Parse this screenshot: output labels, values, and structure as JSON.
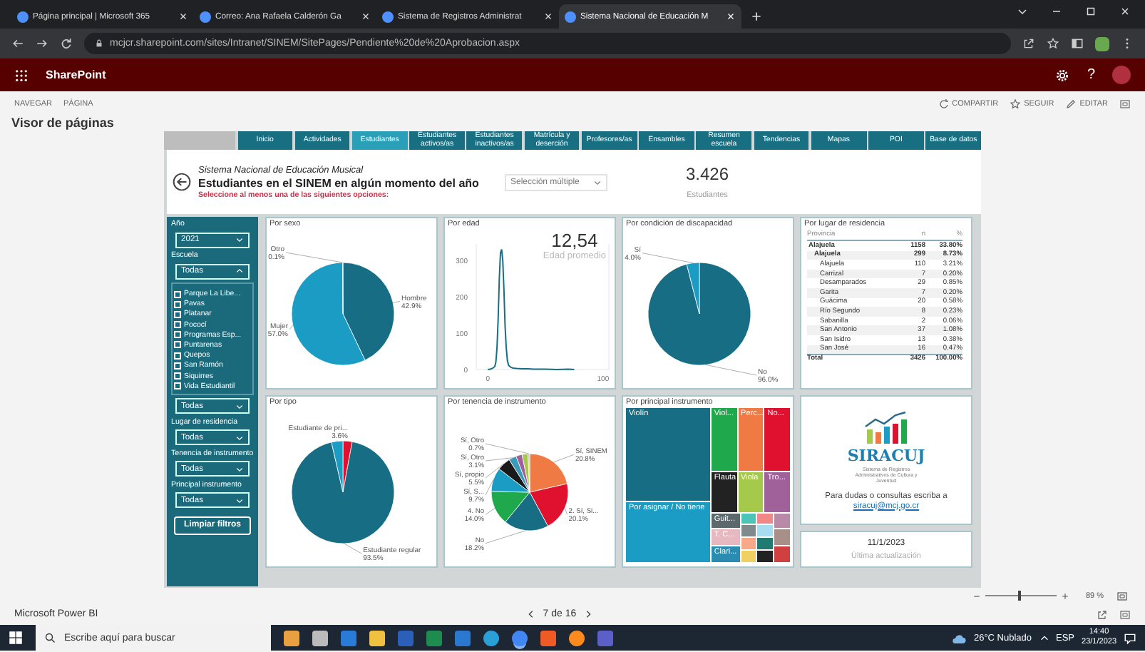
{
  "browser": {
    "tabs": [
      {
        "title": "Página principal | Microsoft 365",
        "selected": false
      },
      {
        "title": "Correo: Ana Rafaela Calderón Ga",
        "selected": false
      },
      {
        "title": "Sistema de Registros Administrat",
        "selected": false
      },
      {
        "title": "Sistema Nacional de Educación M",
        "selected": true
      }
    ],
    "address": "mcjcr.sharepoint.com/sites/Intranet/SINEM/SitePages/Pendiente%20de%20Aprobacion.aspx"
  },
  "suite_bar": {
    "title": "SharePoint",
    "help": "?"
  },
  "page_bar": {
    "nav": [
      "NAVEGAR",
      "PÁGINA"
    ],
    "actions": [
      "COMPARTIR",
      "SEGUIR",
      "EDITAR"
    ],
    "title": "Visor de páginas"
  },
  "report": {
    "tabs": [
      {
        "label": "Inicio",
        "selected": false
      },
      {
        "label": "Actividades",
        "selected": false
      },
      {
        "label": "Estudiantes",
        "selected": true
      },
      {
        "label": "Estudiantes activos/as",
        "selected": false
      },
      {
        "label": "Estudiantes inactivos/as",
        "selected": false
      },
      {
        "label": "Matrícula y deserción",
        "selected": false
      },
      {
        "label": "Profesores/as",
        "selected": false
      },
      {
        "label": "Ensambles",
        "selected": false
      },
      {
        "label": "Resumen escuela",
        "selected": false
      },
      {
        "label": "Tendencias",
        "selected": false
      },
      {
        "label": "Mapas",
        "selected": false
      },
      {
        "label": "POI",
        "selected": false
      },
      {
        "label": "Base de datos",
        "selected": false
      }
    ],
    "header": {
      "subtitle": "Sistema Nacional de Educación Musical",
      "title": "Estudiantes en el SINEM en algún momento del año",
      "prompt": "Seleccione al menos una de las siguientes opciones:",
      "dropdown": "Selección múltiple",
      "kpi_value": "3.426",
      "kpi_label": "Estudiantes"
    },
    "slicers": [
      {
        "label": "Año",
        "value": "2021",
        "expanded": false
      },
      {
        "label": "Escuela",
        "value": "Todas",
        "expanded": true,
        "options": [
          {
            "label": "Parque La Libe...",
            "checked": false
          },
          {
            "label": "Pavas",
            "checked": false
          },
          {
            "label": "Platanar",
            "checked": false
          },
          {
            "label": "Pococí",
            "checked": false
          },
          {
            "label": "Programas Esp...",
            "checked": false
          },
          {
            "label": "Puntarenas",
            "checked": false
          },
          {
            "label": "Quepos",
            "checked": false
          },
          {
            "label": "San Ramón",
            "checked": false
          },
          {
            "label": "Siquirres",
            "checked": false
          },
          {
            "label": "Vida Estudiantil",
            "checked": false
          }
        ]
      },
      {
        "value": "Todas",
        "expanded": false
      },
      {
        "label": "Lugar de residencia",
        "value": "Todas",
        "expanded": false
      },
      {
        "label": "Tenencia de instrumento",
        "value": "Todas",
        "expanded": false
      },
      {
        "label": "Principal instrumento",
        "value": "Todas",
        "expanded": false
      }
    ],
    "clear_button": "Limpiar filtros",
    "visuals": [
      {
        "kind": "pie",
        "chart_data": {
          "type": "pie",
          "title": "Por sexo",
          "categories": [
            "Hombre",
            "Mujer",
            "Otro"
          ],
          "values": [
            42.9,
            57.0,
            0.1
          ],
          "value_labels": [
            "42.9%",
            "57.0%",
            "0.1%"
          ],
          "colors": [
            "#176e84",
            "#1b9cc4",
            "#0e4e5e"
          ]
        }
      },
      {
        "kind": "line",
        "kpi_value": "12,54",
        "kpi_label": "Edad promedio",
        "chart_data": {
          "type": "line",
          "title": "Por edad",
          "x": [
            0,
            2,
            4,
            6,
            7,
            8,
            9,
            10,
            11,
            12,
            13,
            14,
            15,
            16,
            17,
            18,
            20,
            22,
            25,
            30,
            35,
            40,
            50,
            60,
            70,
            75
          ],
          "series": [
            {
              "color": "#176e84",
              "values": [
                0,
                1,
                3,
                8,
                20,
                60,
                140,
                250,
                320,
                330,
                300,
                220,
                120,
                60,
                25,
                12,
                6,
                4,
                3,
                2,
                2,
                1,
                1,
                0,
                1,
                0
              ]
            }
          ],
          "xlim": [
            -10,
            105
          ],
          "ylim": [
            0,
            345
          ],
          "xticks": [
            0,
            100
          ],
          "yticks": [
            0,
            100,
            200,
            300
          ]
        }
      },
      {
        "kind": "pie",
        "chart_data": {
          "type": "pie",
          "title": "Por condición de discapacidad",
          "categories": [
            "No",
            "Sí"
          ],
          "values": [
            96.0,
            4.0
          ],
          "value_labels": [
            "96.0%",
            "4.0%"
          ],
          "colors": [
            "#176e84",
            "#1b9cc4"
          ]
        }
      },
      {
        "kind": "table",
        "title": "Por lugar de residencia",
        "columns": [
          "Provincia",
          "n",
          "%"
        ],
        "rows": [
          {
            "cells": [
              "Alajuela",
              "1158",
              "33.80%"
            ],
            "children": [
              {
                "cells": [
                  "Alajuela",
                  "299",
                  "8.73%"
                ],
                "children": [
                  {
                    "cells": [
                      "Alajuela",
                      "110",
                      "3.21%"
                    ]
                  },
                  {
                    "cells": [
                      "Carrizal",
                      "7",
                      "0.20%"
                    ]
                  },
                  {
                    "cells": [
                      "Desamparados",
                      "29",
                      "0.85%"
                    ]
                  },
                  {
                    "cells": [
                      "Garita",
                      "7",
                      "0.20%"
                    ]
                  },
                  {
                    "cells": [
                      "Guácima",
                      "20",
                      "0.58%"
                    ]
                  },
                  {
                    "cells": [
                      "Río Segundo",
                      "8",
                      "0.23%"
                    ]
                  },
                  {
                    "cells": [
                      "Sabanilla",
                      "2",
                      "0.06%"
                    ]
                  },
                  {
                    "cells": [
                      "San Antonio",
                      "37",
                      "1.08%"
                    ]
                  },
                  {
                    "cells": [
                      "San Isidro",
                      "13",
                      "0.38%"
                    ]
                  },
                  {
                    "cells": [
                      "San José",
                      "16",
                      "0.47%"
                    ]
                  }
                ]
              }
            ]
          }
        ],
        "total": [
          "Total",
          "3426",
          "100.00%"
        ]
      },
      {
        "kind": "pie",
        "chart_data": {
          "type": "pie",
          "title": "Por tipo",
          "categories": [
            null,
            "Estudiante regular",
            "Estudiante de pri..."
          ],
          "values": [
            2.9,
            93.5,
            3.6
          ],
          "value_labels": [
            null,
            "93.5%",
            "3.6%"
          ],
          "colors": [
            "#e0102f",
            "#176e84",
            "#1b9cc4"
          ]
        }
      },
      {
        "kind": "pie",
        "chart_data": {
          "type": "pie",
          "title": "Por tenencia de instrumento",
          "categories": [
            "Sí, SINEM",
            "2. Sí, Si...",
            "No",
            "4. No",
            "Sí, S...",
            "Sí, propio",
            "Sí, Otro",
            null,
            null,
            "Sí, Otro"
          ],
          "values": [
            20.8,
            20.1,
            18.2,
            14.0,
            9.7,
            5.5,
            3.1,
            2.5,
            2.4,
            0.7
          ],
          "value_labels": [
            "20.8%",
            "20.1%",
            "18.2%",
            "14.0%",
            "9.7%",
            "5.5%",
            "3.1%",
            null,
            null,
            "0.7%"
          ],
          "colors": [
            "#ef7a44",
            "#e0102f",
            "#176e84",
            "#20a84c",
            "#1b9cc4",
            "#1a1a1a",
            "#3a9ab8",
            "#a0609a",
            "#a5c94a",
            "#c8c0b8"
          ]
        }
      },
      {
        "kind": "treemap",
        "title": "Por principal instrumento",
        "main": [
          {
            "label": "Violín",
            "color": "#176e84"
          },
          {
            "label": "Por asignar / No tiene",
            "color": "#1b9cc4"
          }
        ],
        "rows": [
          [
            {
              "label": "Viol...",
              "color": "#20a84c"
            },
            {
              "label": "Perc...",
              "color": "#ef7a44"
            },
            {
              "label": "No...",
              "color": "#e0102f"
            }
          ],
          [
            {
              "label": "Flauta",
              "color": "#222222"
            },
            {
              "label": "Viola",
              "color": "#a5c94a"
            },
            {
              "label": "Tro...",
              "color": "#a0609a"
            }
          ]
        ],
        "bottom_columns": [
          [
            {
              "label": "Guit...",
              "color": "#5b686c"
            },
            {
              "label": "T. C...",
              "color": "#e6b8c0"
            },
            {
              "label": "Clari...",
              "color": "#2a8cb0"
            }
          ],
          [
            {
              "color": "#4cc4b8"
            },
            {
              "color": "#7e8a8c"
            },
            {
              "color": "#f6a888"
            },
            {
              "color": "#f0d060"
            }
          ],
          [
            {
              "color": "#f08888"
            },
            {
              "color": "#a8dcf0"
            },
            {
              "color": "#1f7a70"
            },
            {
              "color": "#222222"
            }
          ],
          [
            {
              "color": "#b88aa8"
            },
            {
              "color": "#a89088"
            },
            {
              "color": "#d04040"
            }
          ]
        ]
      }
    ],
    "cards": [
      {
        "kind": "logo",
        "name": "SIRACUJ",
        "tagline": "Sistema de Registros Administrativos de Cultura y Juventud",
        "text": "Para dudas o consultas escriba a",
        "link": "siracuj@mcj.go.cr"
      },
      {
        "kind": "date",
        "value": "11/1/2023",
        "label": "Última actualización"
      }
    ]
  },
  "zoom": {
    "level": 0.45,
    "reading": "89 %"
  },
  "footer": {
    "app": "Microsoft Power BI",
    "page": "7 de 16"
  },
  "taskbar": {
    "search_placeholder": "Escribe aquí para buscar",
    "weather": "26°C Nublado",
    "language": "ESP",
    "time": "14:40",
    "date": "23/1/2023"
  }
}
